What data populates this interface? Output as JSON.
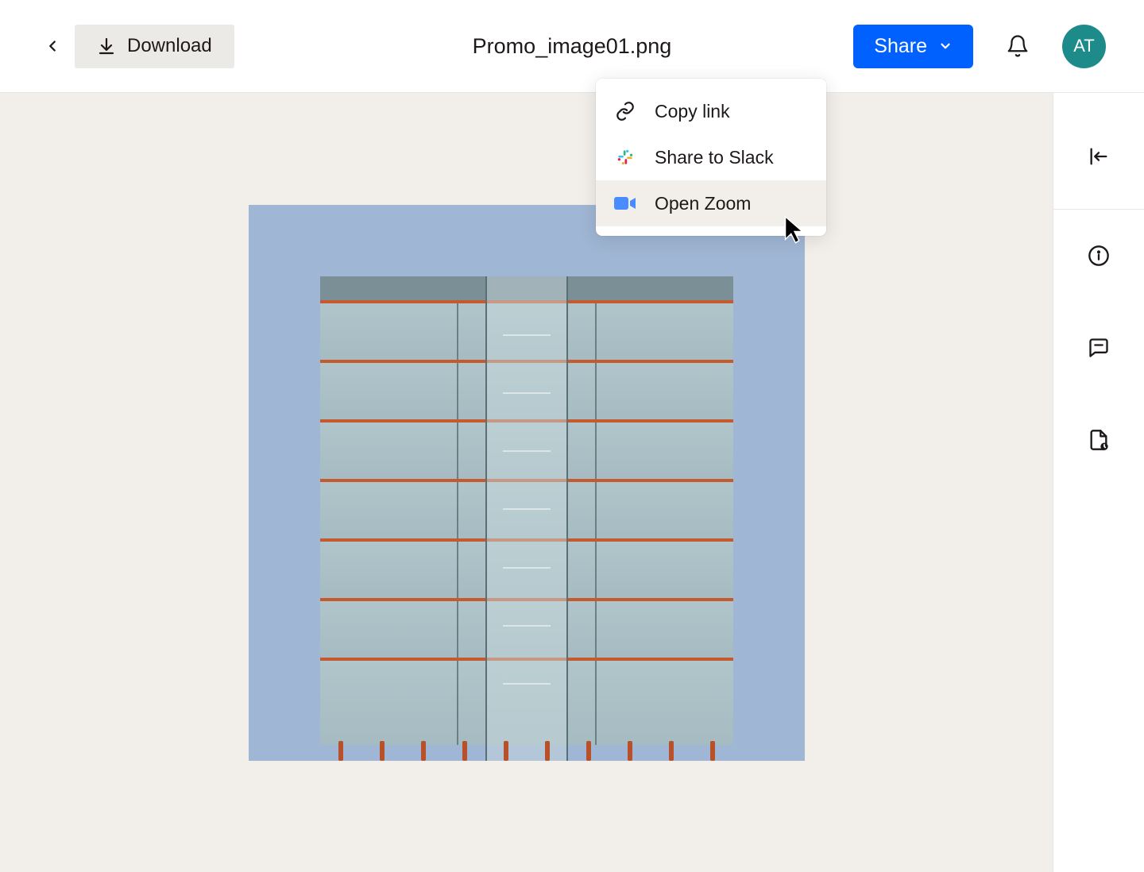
{
  "header": {
    "download_label": "Download",
    "filename": "Promo_image01.png",
    "share_label": "Share",
    "avatar_initials": "AT"
  },
  "share_menu": {
    "items": [
      {
        "label": "Copy link",
        "icon": "link-icon"
      },
      {
        "label": "Share to Slack",
        "icon": "slack-icon"
      },
      {
        "label": "Open Zoom",
        "icon": "zoom-icon"
      }
    ]
  },
  "sidebar": {
    "collapse_icon": "collapse-icon",
    "info_icon": "info-icon",
    "comment_icon": "comment-icon",
    "file_activity_icon": "file-activity-icon"
  },
  "colors": {
    "accent": "#0061fe",
    "avatar_bg": "#1e8b8b",
    "canvas_bg": "#f2efeb"
  }
}
